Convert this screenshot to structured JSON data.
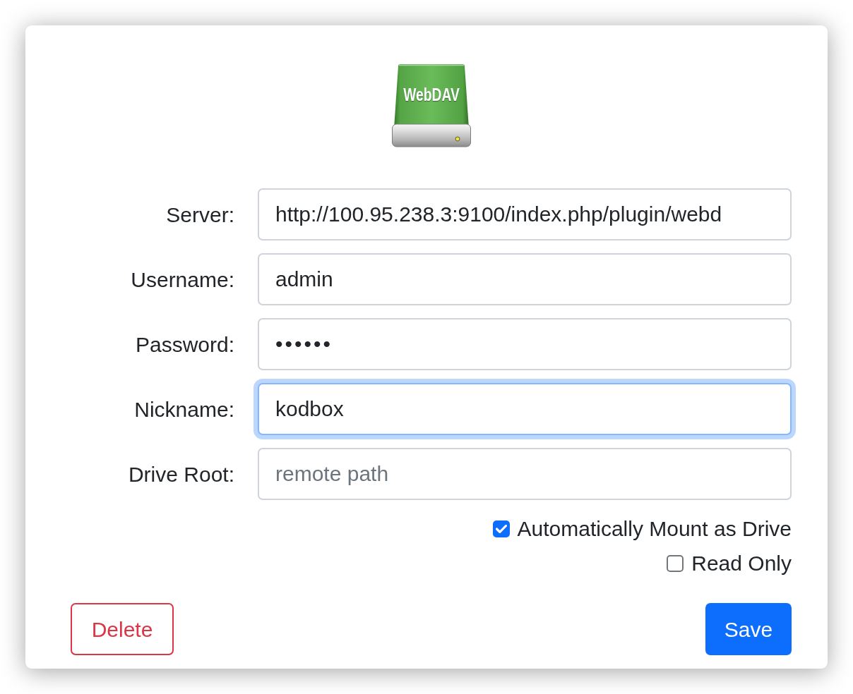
{
  "drive_icon": {
    "label": "WebDAV"
  },
  "fields": [
    {
      "label": "Server:",
      "kind": "text",
      "value": "http://100.95.238.3:9100/index.php/plugin/webd",
      "focused": false
    },
    {
      "label": "Username:",
      "kind": "text",
      "value": "admin",
      "focused": false
    },
    {
      "label": "Password:",
      "kind": "password",
      "value": "••••••",
      "focused": false
    },
    {
      "label": "Nickname:",
      "kind": "text",
      "value": "kodbox",
      "focused": true
    },
    {
      "label": "Drive Root:",
      "kind": "text",
      "placeholder": "remote path",
      "focused": false
    }
  ],
  "options": [
    {
      "label": "Automatically Mount as Drive",
      "checked": true
    },
    {
      "label": "Read Only",
      "checked": false
    }
  ],
  "buttons": [
    {
      "label": "Delete",
      "kind": "danger"
    },
    {
      "label": "Save",
      "kind": "primary"
    }
  ]
}
